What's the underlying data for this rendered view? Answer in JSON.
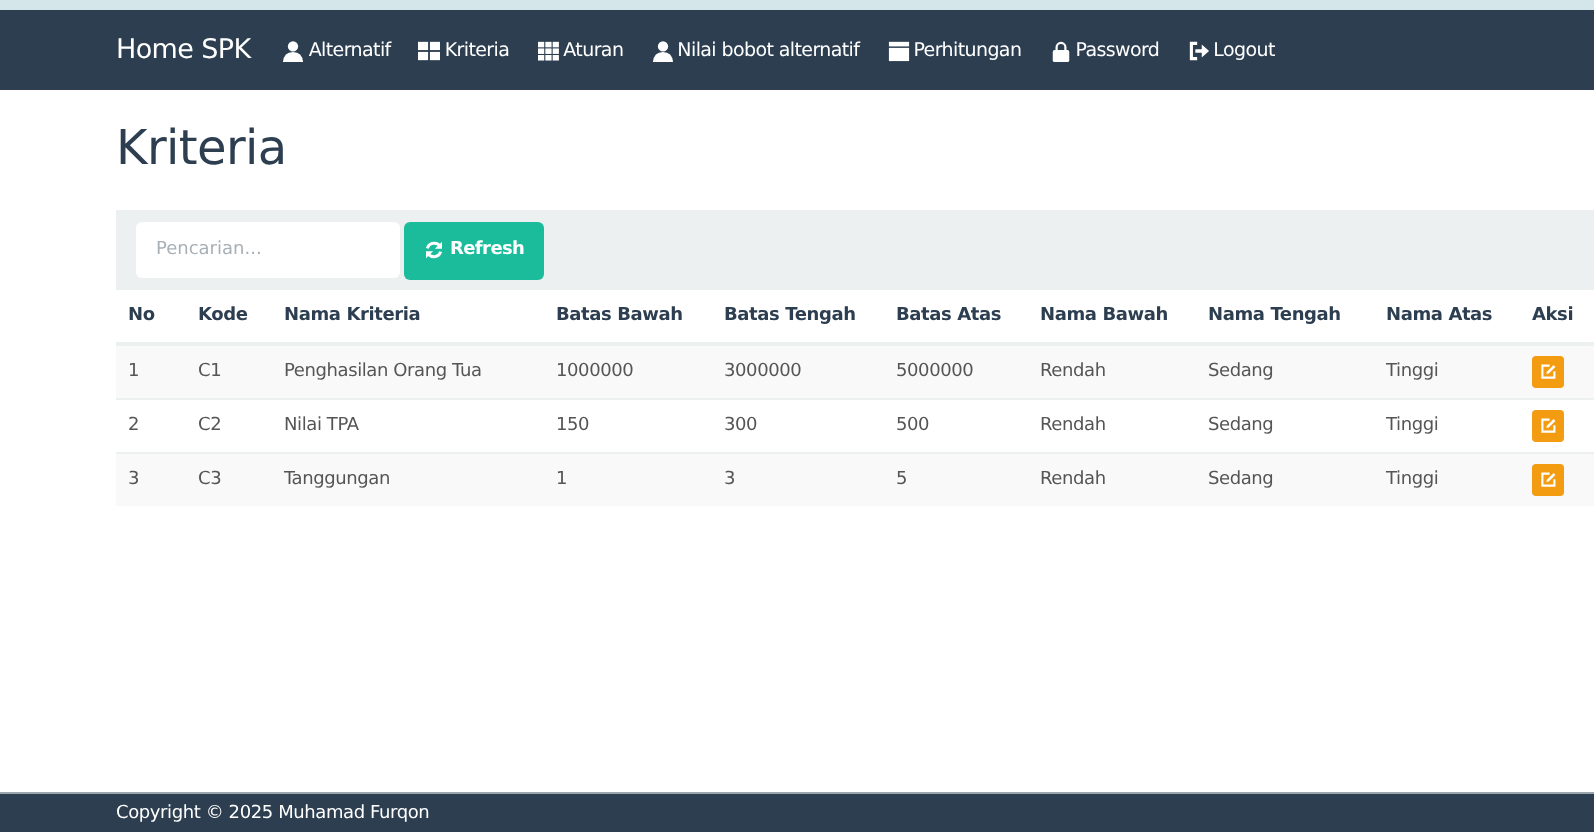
{
  "navbar": {
    "brand": "Home SPK",
    "items": [
      {
        "label": "Alternatif",
        "kind": "user"
      },
      {
        "label": "Kriteria",
        "kind": "tiles"
      },
      {
        "label": "Aturan",
        "kind": "table"
      },
      {
        "label": "Nilai bobot alternatif",
        "kind": "user"
      },
      {
        "label": "Perhitungan",
        "kind": "calendar"
      },
      {
        "label": "Password",
        "kind": "lock"
      },
      {
        "label": "Logout",
        "kind": "logout"
      }
    ]
  },
  "page_title": "Kriteria",
  "toolbar": {
    "search": {
      "placeholder": "Pencarian..."
    },
    "refresh_button": "Refresh"
  },
  "table": {
    "columns": [
      "No",
      "Kode",
      "Nama Kriteria",
      "Batas Bawah",
      "Batas Tengah",
      "Batas Atas",
      "Nama Bawah",
      "Nama Tengah",
      "Nama Atas",
      "Aksi"
    ],
    "rows": [
      [
        "1",
        "C1",
        "Penghasilan Orang Tua",
        "1000000",
        "3000000",
        "5000000",
        "Rendah",
        "Sedang",
        "Tinggi"
      ],
      [
        "2",
        "C2",
        "Nilai TPA",
        "150",
        "300",
        "500",
        "Rendah",
        "Sedang",
        "Tinggi"
      ],
      [
        "3",
        "C3",
        "Tanggungan",
        "1",
        "3",
        "5",
        "Rendah",
        "Sedang",
        "Tinggi"
      ]
    ]
  },
  "footer": "Copyright © 2025 Muhamad Furqon"
}
